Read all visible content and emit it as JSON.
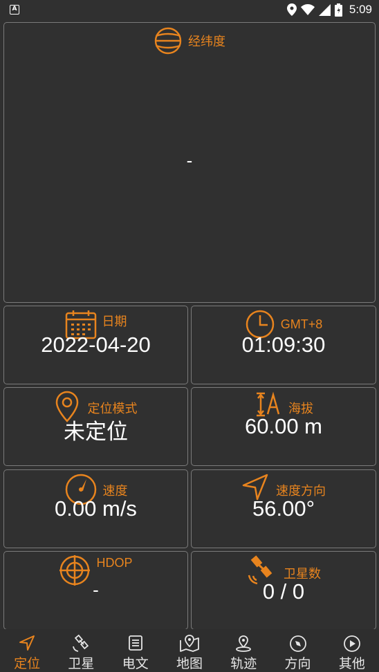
{
  "status_bar": {
    "time": "5:09",
    "app_icon_letter": "A"
  },
  "latlon": {
    "label": "经纬度",
    "value": "-"
  },
  "date": {
    "label": "日期",
    "value": "2022-04-20"
  },
  "time": {
    "label": "GMT+8",
    "value": "01:09:30"
  },
  "fix_mode": {
    "label": "定位模式",
    "value": "未定位"
  },
  "altitude": {
    "label": "海拔",
    "value": "60.00 m"
  },
  "speed": {
    "label": "速度",
    "value": "0.00 m/s"
  },
  "heading": {
    "label": "速度方向",
    "value": "56.00°"
  },
  "hdop": {
    "label": "HDOP",
    "value": "-"
  },
  "satellites": {
    "label": "卫星数",
    "value": "0 / 0"
  },
  "nav": {
    "items": [
      {
        "label": "定位",
        "icon": "navigation-arrow-icon",
        "active": true
      },
      {
        "label": "卫星",
        "icon": "satellite-icon"
      },
      {
        "label": "电文",
        "icon": "document-icon"
      },
      {
        "label": "地图",
        "icon": "map-icon"
      },
      {
        "label": "轨迹",
        "icon": "track-pin-icon"
      },
      {
        "label": "方向",
        "icon": "compass-icon"
      },
      {
        "label": "其他",
        "icon": "play-circle-icon"
      }
    ]
  },
  "colors": {
    "accent": "#e8841e",
    "background": "#303030",
    "border": "#7b7b7b",
    "text": "#ffffff"
  }
}
